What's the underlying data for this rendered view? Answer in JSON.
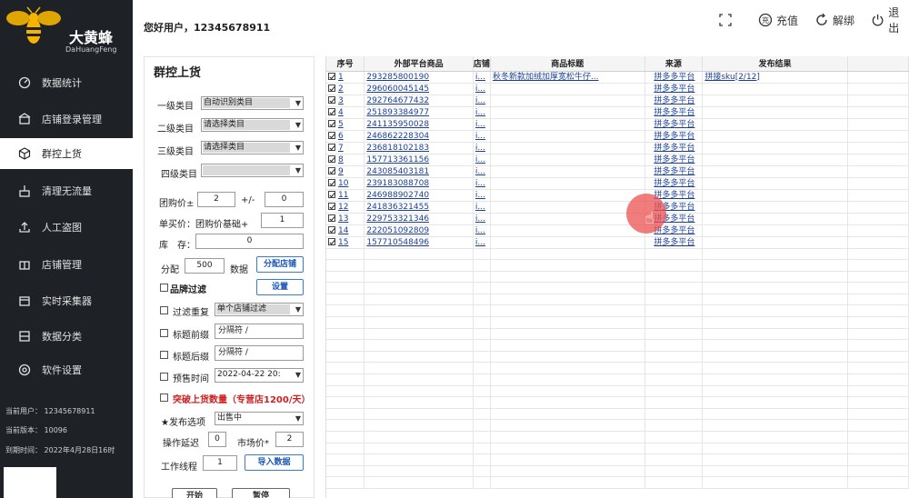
{
  "app": {
    "name": "大黄蜂",
    "name_en": "DaHuangFeng"
  },
  "topbar": {
    "greeting": "您好用户，12345678911",
    "actions": [
      {
        "label": "",
        "icon": "fullscreen-icon"
      },
      {
        "label": "充值",
        "icon": "recharge-icon"
      },
      {
        "label": "解绑",
        "icon": "unbind-icon"
      },
      {
        "label": "退出",
        "icon": "power-icon"
      }
    ]
  },
  "sidebar": {
    "items": [
      {
        "label": "数据统计",
        "icon": "dashboard-icon"
      },
      {
        "label": "店铺登录管理",
        "icon": "store-login-icon"
      },
      {
        "label": "群控上货",
        "icon": "cube-icon",
        "active": true
      },
      {
        "label": "清理无流量",
        "icon": "clean-icon"
      },
      {
        "label": "人工盗图",
        "icon": "upload-icon"
      },
      {
        "label": "店铺管理",
        "icon": "store-icon"
      },
      {
        "label": "实时采集器",
        "icon": "collector-icon"
      },
      {
        "label": "数据分类",
        "icon": "category-icon"
      },
      {
        "label": "软件设置",
        "icon": "settings-icon"
      }
    ],
    "info": {
      "user": "当前用户： 12345678911",
      "version": "当前版本： 10096",
      "expire": "到期时间： 2022年4月28日16时"
    }
  },
  "panel": {
    "title": "群控上货",
    "cat1_label": "一级类目",
    "cat1_value": "自动识别类目",
    "cat2_label": "二级类目",
    "cat2_value": "请选择类目",
    "cat3_label": "三级类目",
    "cat3_value": "请选择类目",
    "cat4_label": "四级类目",
    "cat4_value": "",
    "group_price_label": "团购价±",
    "group_price_value": "2",
    "plusminus_label": "+/-",
    "plusminus_value": "0",
    "single_price_label": "单买价：团购价基础+",
    "single_price_value": "1",
    "stock_label": "库　存：",
    "stock_value": "0",
    "allot_label": "分配",
    "allot_value": "500",
    "allot_unit": "数据",
    "allot_button": "分配店铺",
    "brand_filter_label": "品牌过滤",
    "settings_button": "设置",
    "dedup_label": "过滤重复",
    "dedup_value": "单个店铺过滤",
    "title_prefix_label": "标题前缀",
    "title_prefix_value": "分隔符 /",
    "title_suffix_label": "标题后缀",
    "title_suffix_value": "分隔符 /",
    "presale_label": "预售时间",
    "presale_value": "2022-04-22 20:",
    "break_limit_label": "突破上货数量（专营店1200/天）",
    "publish_label": "★发布选项",
    "publish_value": "出售中",
    "delay_label": "操作延迟",
    "delay_value": "0",
    "market_label": "市场价*",
    "market_value": "2",
    "threads_label": "工作线程",
    "threads_value": "1",
    "import_button": "导入数据",
    "start_button": "开始",
    "pause_button": "暂停"
  },
  "table": {
    "headers": [
      "序号",
      "外部平台商品",
      "店铺",
      "商品标题",
      "来源",
      "发布结果"
    ],
    "rows": [
      {
        "no": "1",
        "id": "293285800190",
        "shop": "i...",
        "title": "秋冬新款加绒加厚宽松牛仔...",
        "source": "拼多多平台",
        "result": "拼接sku[2/12]"
      },
      {
        "no": "2",
        "id": "296060045145",
        "shop": "i...",
        "title": "",
        "source": "拼多多平台",
        "result": ""
      },
      {
        "no": "3",
        "id": "292764677432",
        "shop": "i...",
        "title": "",
        "source": "拼多多平台",
        "result": ""
      },
      {
        "no": "4",
        "id": "251893384977",
        "shop": "i...",
        "title": "",
        "source": "拼多多平台",
        "result": ""
      },
      {
        "no": "5",
        "id": "241135950028",
        "shop": "i...",
        "title": "",
        "source": "拼多多平台",
        "result": ""
      },
      {
        "no": "6",
        "id": "246862228304",
        "shop": "i...",
        "title": "",
        "source": "拼多多平台",
        "result": ""
      },
      {
        "no": "7",
        "id": "236818102183",
        "shop": "i...",
        "title": "",
        "source": "拼多多平台",
        "result": ""
      },
      {
        "no": "8",
        "id": "157713361156",
        "shop": "i...",
        "title": "",
        "source": "拼多多平台",
        "result": ""
      },
      {
        "no": "9",
        "id": "243085403181",
        "shop": "i...",
        "title": "",
        "source": "拼多多平台",
        "result": ""
      },
      {
        "no": "10",
        "id": "239183088708",
        "shop": "i...",
        "title": "",
        "source": "拼多多平台",
        "result": ""
      },
      {
        "no": "11",
        "id": "246988902740",
        "shop": "i...",
        "title": "",
        "source": "拼多多平台",
        "result": ""
      },
      {
        "no": "12",
        "id": "241836321455",
        "shop": "i...",
        "title": "",
        "source": "拼多多平台",
        "result": ""
      },
      {
        "no": "13",
        "id": "229753321346",
        "shop": "i...",
        "title": "",
        "source": "拼多多平台",
        "result": ""
      },
      {
        "no": "14",
        "id": "222051092809",
        "shop": "i...",
        "title": "",
        "source": "拼多多平台",
        "result": ""
      },
      {
        "no": "15",
        "id": "157710548496",
        "shop": "i...",
        "title": "",
        "source": "拼多多平台",
        "result": ""
      }
    ]
  },
  "colors": {
    "sidebar_bg": "#1e2126",
    "link": "#1a3f99",
    "accent_red": "#d02020",
    "button_blue": "#3b7bd4",
    "cursor_dot": "#eb5050"
  }
}
